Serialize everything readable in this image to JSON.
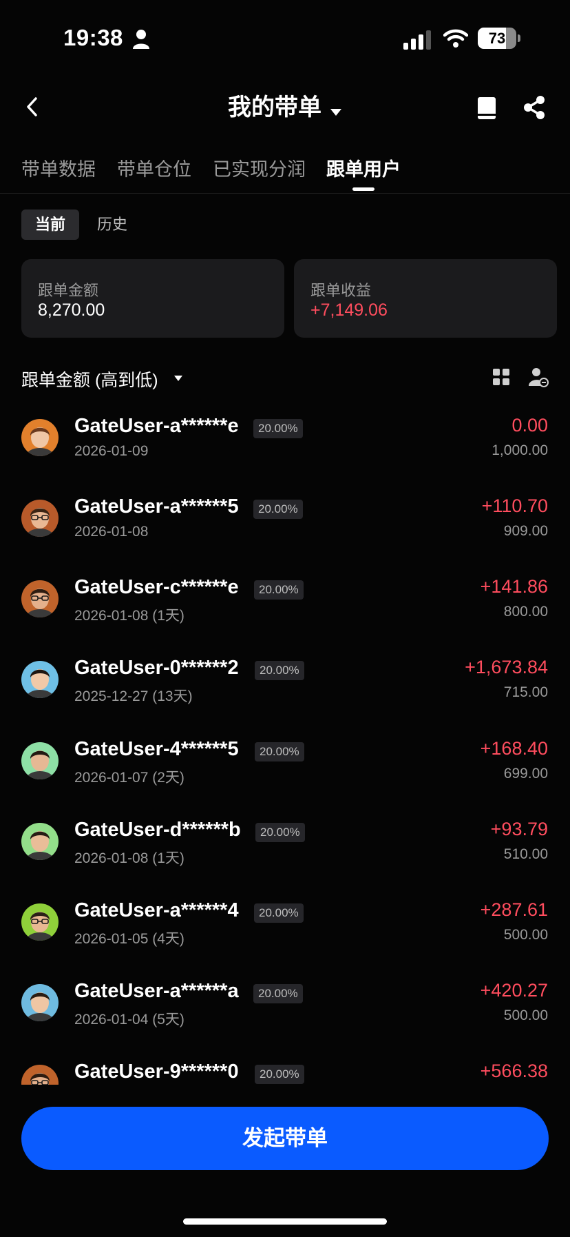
{
  "status_bar": {
    "time": "19:38",
    "battery": "73",
    "battery_level": 0.73
  },
  "nav": {
    "title": "我的带单",
    "icons": [
      "back-icon",
      "chevron-down-icon",
      "book-icon",
      "share-icon"
    ]
  },
  "tabs": [
    "带单数据",
    "带单仓位",
    "已实现分润",
    "跟单用户"
  ],
  "active_tab": "跟单用户",
  "segment": {
    "current": "当前",
    "history": "历史"
  },
  "summary": {
    "follow_amount_label": "跟单金额",
    "follow_amount_value": "8,270.00",
    "follow_profit_label": "跟单收益",
    "follow_profit_value": "+7,149.06"
  },
  "sort": {
    "label": "跟单金额 (高到低)"
  },
  "colors": {
    "accent": "#0a5bff",
    "profit": "#ff4d5e",
    "card_bg": "#1b1b1d",
    "badge_bg": "#26262a",
    "background": "#050505"
  },
  "users": [
    {
      "name": "GateUser-a******e",
      "ratio": "20.00%",
      "date": "2026-01-09",
      "profit": "0.00",
      "amount": "1,000.00",
      "avatar_bg": "#e2802c",
      "skin": "#f0c7a6",
      "hair": "#6b3a1e",
      "glasses": false
    },
    {
      "name": "GateUser-a******5",
      "ratio": "20.00%",
      "date": "2026-01-08",
      "profit": "+110.70",
      "amount": "909.00",
      "avatar_bg": "#b85a2a",
      "skin": "#e9b894",
      "hair": "#3a2414",
      "glasses": true
    },
    {
      "name": "GateUser-c******e",
      "ratio": "20.00%",
      "date": "2026-01-08 (1天)",
      "profit": "+141.86",
      "amount": "800.00",
      "avatar_bg": "#c0632b",
      "skin": "#e4b08c",
      "hair": "#2e1c10",
      "glasses": true
    },
    {
      "name": "GateUser-0******2",
      "ratio": "20.00%",
      "date": "2025-12-27 (13天)",
      "profit": "+1,673.84",
      "amount": "715.00",
      "avatar_bg": "#6fc0e6",
      "skin": "#f1c9a8",
      "hair": "#1f1712",
      "glasses": false
    },
    {
      "name": "GateUser-4******5",
      "ratio": "20.00%",
      "date": "2026-01-07 (2天)",
      "profit": "+168.40",
      "amount": "699.00",
      "avatar_bg": "#8ee0a6",
      "skin": "#e6b894",
      "hair": "#221a12",
      "glasses": false
    },
    {
      "name": "GateUser-d******b",
      "ratio": "20.00%",
      "date": "2026-01-08 (1天)",
      "profit": "+93.79",
      "amount": "510.00",
      "avatar_bg": "#93de8a",
      "skin": "#e9bd98",
      "hair": "#261c14",
      "glasses": false
    },
    {
      "name": "GateUser-a******4",
      "ratio": "20.00%",
      "date": "2026-01-05 (4天)",
      "profit": "+287.61",
      "amount": "500.00",
      "avatar_bg": "#8fd03a",
      "skin": "#e8b892",
      "hair": "#2a2018",
      "glasses": true
    },
    {
      "name": "GateUser-a******a",
      "ratio": "20.00%",
      "date": "2026-01-04 (5天)",
      "profit": "+420.27",
      "amount": "500.00",
      "avatar_bg": "#6fbbe0",
      "skin": "#efc6a4",
      "hair": "#2b1d12",
      "glasses": false
    },
    {
      "name": "GateUser-9******0",
      "ratio": "20.00%",
      "date": "",
      "profit": "+566.38",
      "amount": "",
      "avatar_bg": "#c0632b",
      "skin": "#e4b08c",
      "hair": "#2e1c10",
      "glasses": true
    }
  ],
  "cta": {
    "label": "发起带单"
  }
}
